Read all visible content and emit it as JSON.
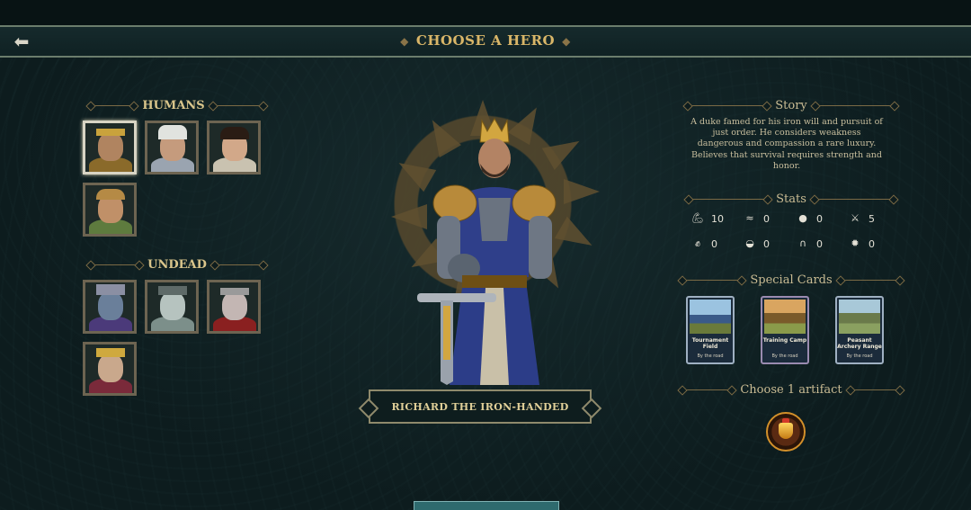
{
  "header": {
    "title": "CHOOSE A HERO",
    "back_icon": "arrow-left-icon"
  },
  "factions": [
    {
      "name": "HUMANS",
      "heroes": [
        {
          "id": "richard",
          "selected": true
        },
        {
          "id": "human-2"
        },
        {
          "id": "human-3"
        },
        {
          "id": "human-4"
        }
      ]
    },
    {
      "name": "UNDEAD",
      "heroes": [
        {
          "id": "undead-1"
        },
        {
          "id": "undead-2"
        },
        {
          "id": "undead-3"
        },
        {
          "id": "undead-4"
        }
      ]
    }
  ],
  "hero": {
    "name": "RICHARD THE IRON-HANDED"
  },
  "story": {
    "heading": "Story",
    "text": "A duke famed for his iron will and pursuit of just order. He considers weakness dangerous and compassion a rare luxury. Believes that survival requires strength and honor."
  },
  "stats": {
    "heading": "Stats",
    "items": [
      {
        "icon": "strength-arm-icon",
        "value": "10"
      },
      {
        "icon": "speed-wings-icon",
        "value": "0"
      },
      {
        "icon": "speech-bubble-icon",
        "value": "0"
      },
      {
        "icon": "crossed-swords-icon",
        "value": "5"
      },
      {
        "icon": "fist-icon",
        "value": "0"
      },
      {
        "icon": "mask-icon",
        "value": "0"
      },
      {
        "icon": "horseshoe-icon",
        "value": "0"
      },
      {
        "icon": "burst-icon",
        "value": "0"
      }
    ]
  },
  "special_cards": {
    "heading": "Special Cards",
    "items": [
      {
        "name": "Tournament Field",
        "sub": "By the road"
      },
      {
        "name": "Training Camp",
        "sub": "By the road"
      },
      {
        "name": "Peasant Archery Range",
        "sub": "By the road"
      }
    ]
  },
  "artifact": {
    "heading": "Choose 1 artifact",
    "icon": "golden-amulet-icon"
  },
  "colors": {
    "accent_gold": "#d9b668",
    "background": "#0d1c1e",
    "button_teal": "#2e6a6e"
  }
}
